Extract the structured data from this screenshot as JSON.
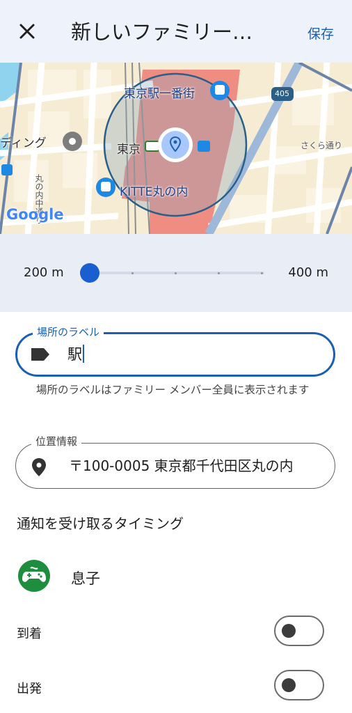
{
  "header": {
    "close_icon": "close-icon",
    "title": "新しいファミリー…",
    "save_label": "保存"
  },
  "map": {
    "labels": {
      "ichibangai": "東京駅一番街",
      "tokyo": "東京",
      "kitte": "KITTE丸の内",
      "building": "ディング",
      "sakura": "さくら通り",
      "nakadori": "丸の内中通り",
      "route": "405"
    },
    "logo": "Google",
    "center_pin_icon": "location-pin-icon"
  },
  "radius": {
    "min_label": "200 m",
    "max_label": "400 m",
    "value_m": 200
  },
  "place_label": {
    "caption": "場所のラベル",
    "value": "駅",
    "icon": "label-tag-icon",
    "helper": "場所のラベルはファミリー メンバー全員に表示されます"
  },
  "location": {
    "caption": "位置情報",
    "value": "〒100-0005 東京都千代田区丸の内",
    "icon": "location-pin-icon"
  },
  "notify": {
    "section_title": "通知を受け取るタイミング",
    "member": {
      "name": "息子",
      "avatar_icon": "gamepad-icon"
    },
    "arrival": {
      "label": "到着",
      "on": false
    },
    "departure": {
      "label": "出発",
      "on": false
    }
  },
  "colors": {
    "accent": "#1a5fb4",
    "header_bg": "#eef3fb",
    "avatar_green": "#1e8e3e",
    "station_red": "#ee6b5f"
  }
}
